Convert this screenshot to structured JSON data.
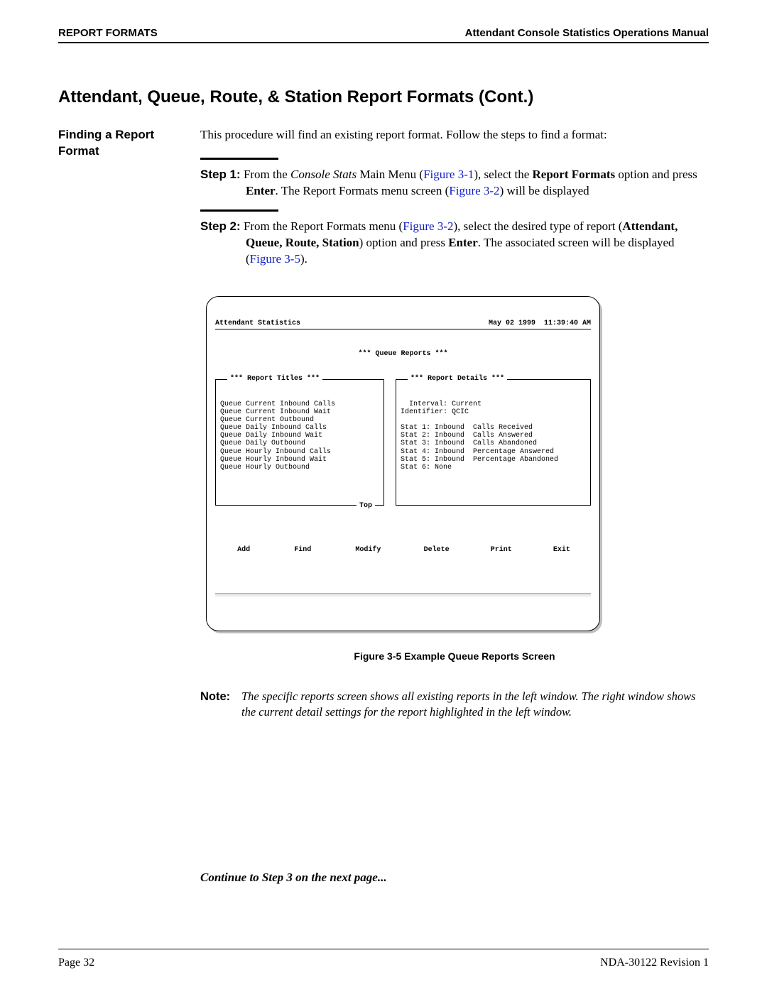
{
  "header": {
    "left": "REPORT FORMATS",
    "right": "Attendant Console Statistics Operations Manual"
  },
  "section_title": "Attendant, Queue, Route, & Station Report Formats (Cont.)",
  "sidehead": "Finding a Report Format",
  "intro": "This procedure will find an existing report format. Follow the steps to find a format:",
  "steps": [
    {
      "label": "Step 1:",
      "pre": "From the ",
      "ital1": "Console Stats",
      "mid1": " Main Menu (",
      "link1": "Figure 3-1",
      "mid2": "), select the ",
      "bold1": "Report Formats",
      "mid3": " option and press ",
      "bold2": "Enter",
      "mid4": ". The Report Formats menu screen (",
      "link2": "Figure 3-2",
      "post": ") will be displayed"
    },
    {
      "label": "Step 2:",
      "pre": "From the Report Formats menu (",
      "link1": "Figure 3-2",
      "mid1": "), select the desired type of report (",
      "bold1": "Attendant, Queue, Route, Station",
      "mid2": ") option and press ",
      "bold2": "Enter",
      "mid3": ". The associated screen will be displayed (",
      "link2": "Figure 3-5",
      "post": ")."
    }
  ],
  "terminal": {
    "app_title": "Attendant Statistics",
    "datetime": "May 02 1999  11:39:40 AM",
    "screen_title": "*** Queue Reports ***",
    "left_panel_title": "*** Report Titles ***",
    "left_items": [
      "Queue Current Inbound Calls",
      "Queue Current Inbound Wait",
      "Queue Current Outbound",
      "Queue Daily Inbound Calls",
      "Queue Daily Inbound Wait",
      "Queue Daily Outbound",
      "Queue Hourly Inbound Calls",
      "Queue Hourly Inbound Wait",
      "Queue Hourly Outbound"
    ],
    "left_bottom": "Top",
    "right_panel_title": "*** Report Details ***",
    "right_header1": "  Interval: Current",
    "right_header2": "Identifier: QCIC",
    "right_stats": [
      "Stat 1: Inbound  Calls Received",
      "Stat 2: Inbound  Calls Answered",
      "Stat 3: Inbound  Calls Abandoned",
      "Stat 4: Inbound  Percentage Answered",
      "Stat 5: Inbound  Percentage Abandoned",
      "Stat 6: None"
    ],
    "buttons": [
      "Add",
      "Find",
      "Modify",
      "Delete",
      "Print",
      "Exit"
    ]
  },
  "figure_caption": "Figure 3-5   Example Queue Reports Screen",
  "note": {
    "label": "Note:",
    "text": "The specific reports screen shows all existing reports in the left window. The right window shows the current detail settings for the report highlighted in the left window."
  },
  "continue_text": "Continue to Step 3 on the next page...",
  "footer": {
    "left": "Page 32",
    "right": "NDA-30122   Revision 1"
  }
}
